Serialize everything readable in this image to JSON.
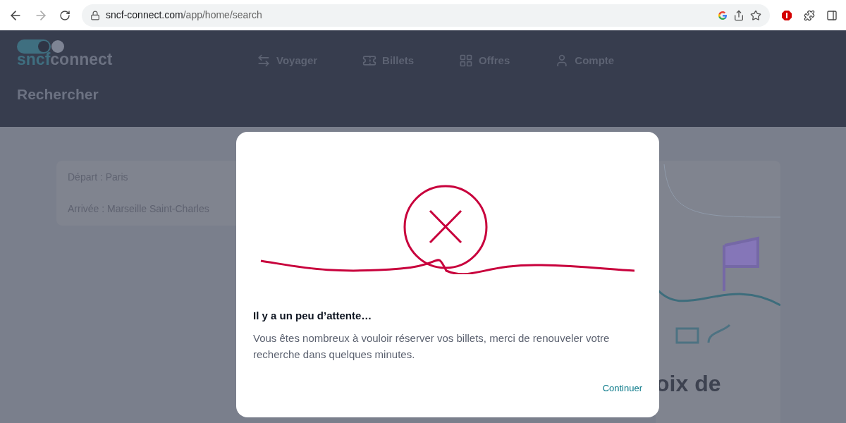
{
  "browser": {
    "url_host": "sncf-connect.com",
    "url_path": "/app/home/search"
  },
  "header": {
    "logo": [
      "sncf",
      "connect"
    ],
    "nav": [
      {
        "label": "Voyager",
        "kind": "route"
      },
      {
        "label": "Billets",
        "kind": "ticket"
      },
      {
        "label": "Offres",
        "kind": "offer"
      },
      {
        "label": "Compte",
        "kind": "user"
      }
    ],
    "page_title": "Rechercher"
  },
  "search_card": {
    "rows": [
      "Départ : Paris",
      "Arrivée : Marseille Saint-Charles"
    ]
  },
  "side_card": {
    "heading": "oix de"
  },
  "dialog": {
    "title": "Il y a un peu d’attente…",
    "message": "Vous êtes nombreux à vouloir réserver vos billets, merci de renouveler votre recherche dans quelques minutes.",
    "action": "Continuer"
  }
}
